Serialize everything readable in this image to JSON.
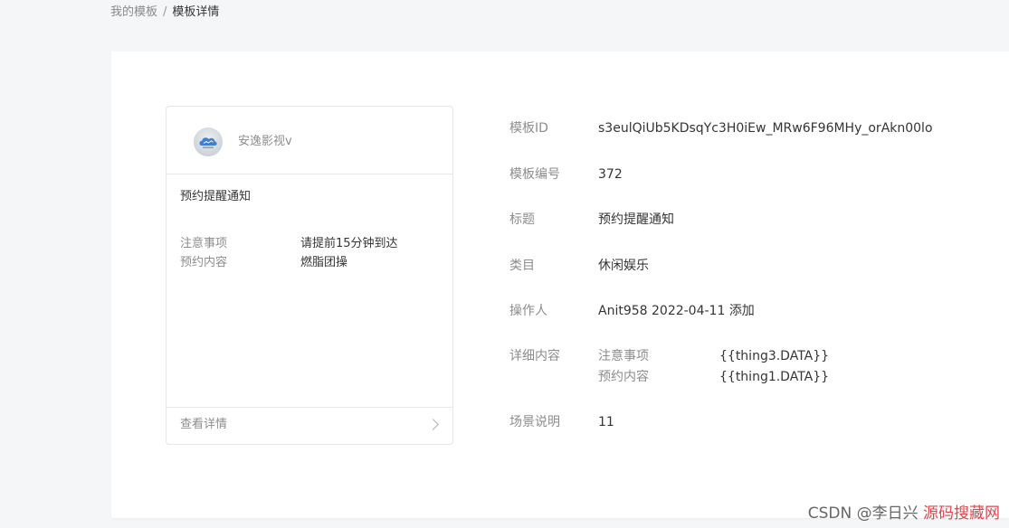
{
  "breadcrumb": {
    "parent": "我的模板",
    "separator": "/",
    "current": "模板详情"
  },
  "preview_card": {
    "account_name": "安逸影视v",
    "title": "预约提醒通知",
    "fields": [
      {
        "key": "注意事项",
        "value": "请提前15分钟到达"
      },
      {
        "key": "预约内容",
        "value": "燃脂团操"
      }
    ],
    "footer_label": "查看详情"
  },
  "details": {
    "template_id_label": "模板ID",
    "template_id_value": "s3eulQiUb5KDsqYc3H0iEw_MRw6F96MHy_orAkn00lo",
    "template_no_label": "模板编号",
    "template_no_value": "372",
    "title_label": "标题",
    "title_value": "预约提醒通知",
    "category_label": "类目",
    "category_value": "休闲娱乐",
    "operator_label": "操作人",
    "operator_value": "Anit958 2022-04-11 添加",
    "content_label": "详细内容",
    "content_items": [
      {
        "key": "注意事项",
        "value": "{{thing3.DATA}}"
      },
      {
        "key": "预约内容",
        "value": "{{thing1.DATA}}"
      }
    ],
    "scene_label": "场景说明",
    "scene_value": "11"
  },
  "watermark": {
    "text": "CSDN @李日兴",
    "overlay": "源码搜藏网"
  },
  "colors": {
    "page_bg": "#f5f6f7",
    "panel_bg": "#ffffff",
    "label_gray": "#8d8d8d",
    "text_dark": "#353535",
    "border": "#e4e6ea",
    "watermark_red": "#d9252b"
  },
  "icons": {
    "avatar": "cloud-logo-icon",
    "footer_arrow": "chevron-right-icon"
  }
}
